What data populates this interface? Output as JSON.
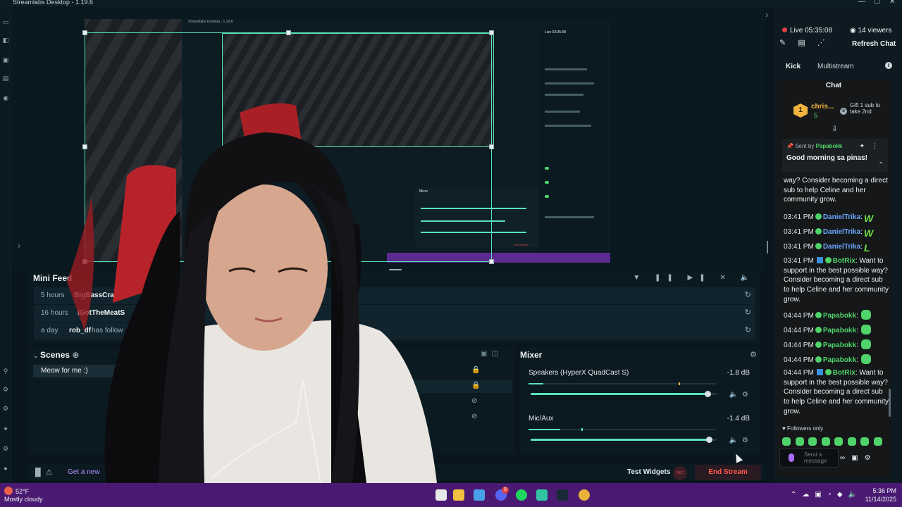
{
  "window": {
    "title": "Streamlabs Desktop - 1.19.6",
    "controls": [
      "—",
      "☐",
      "✕"
    ]
  },
  "nested_preview": {
    "title": "Streamlabs Desktop - 1.19.6",
    "live": "Live 03:35:08",
    "mixer_title": "Mixer",
    "end_stream": "End Stream"
  },
  "minifeed": {
    "title": "Mini Feed",
    "controls": [
      "filter-icon",
      "pause-icon",
      "skip-icon",
      "mute-alerts-icon",
      "volume-icon"
    ],
    "rows": [
      {
        "age": "5 hours",
        "user": "BigBassCraack",
        "action": ""
      },
      {
        "age": "16 hours",
        "user": "IGotTheMeatS",
        "action": ""
      },
      {
        "age": "a day",
        "user": "rob_df",
        "action": "has follow"
      }
    ]
  },
  "scenes": {
    "title": "Scenes",
    "items": [
      "Meow for me :)"
    ]
  },
  "mixer": {
    "title": "Mixer",
    "channels": [
      {
        "name": "Speakers (HyperX QuadCast S)",
        "db": "-1.8 dB",
        "level": 0.08,
        "volume": 0.95
      },
      {
        "name": "Mic/Aux",
        "db": "-1.4 dB",
        "level": 0.17,
        "volume": 0.96
      }
    ]
  },
  "footer": {
    "get_more": "Get a new",
    "test_widgets": "Test Widgets",
    "rec_label": "REC",
    "end_stream": "End Stream"
  },
  "chat_panel": {
    "live_time": "Live 05:35:08",
    "viewers": "14 viewers",
    "refresh": "Refresh Chat",
    "tabs": [
      "Kick",
      "Multistream"
    ],
    "chat_title": "Chat",
    "gifter": {
      "rank": "1",
      "name": "chris...",
      "count": "5",
      "cta": "Gift 1 sub to take 2nd"
    },
    "pinned": {
      "sent_by_label": "Sent by",
      "sent_by_user": "Papabokk",
      "message": "Good morning sa pinas!"
    },
    "messages": [
      {
        "time": "",
        "user": "",
        "text": "way? Consider becoming a direct sub to help Celine and her community grow."
      },
      {
        "time": "03:41 PM",
        "user": "DanielTrika",
        "text": ":"
      },
      {
        "time": "03:41 PM",
        "user": "DanielTrika",
        "text": ":"
      },
      {
        "time": "03:41 PM",
        "user": "DanielTrika",
        "text": ":"
      },
      {
        "time": "03:41 PM",
        "user": "BotRix",
        "text": ": Want to support in the best possible way? Consider becoming a direct sub to help Celine and her community grow."
      },
      {
        "time": "04:44 PM",
        "user": "Papabokk",
        "text": ":"
      },
      {
        "time": "04:44 PM",
        "user": "Papabokk",
        "text": ":"
      },
      {
        "time": "04:44 PM",
        "user": "Papabokk",
        "text": ":"
      },
      {
        "time": "04:44 PM",
        "user": "Papabokk",
        "text": ":"
      },
      {
        "time": "04:44 PM",
        "user": "BotRix",
        "text": ": Want to support in the best possible way? Consider becoming a direct sub to help Celine and her community grow."
      }
    ],
    "followers_only": "Followers only",
    "input_placeholder": "Send a message"
  },
  "taskbar": {
    "temp": "52°F",
    "weather": "Mostly cloudy",
    "time": "5:36 PM",
    "date": "11/14/2025",
    "discord_badge": "9"
  }
}
